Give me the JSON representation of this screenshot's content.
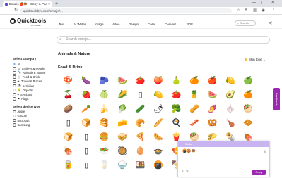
{
  "browser": {
    "tab_title": "Emojis 🍎🍩 - Copy & Paste E...",
    "tab_close": "×",
    "new_tab": "+",
    "url": "quicktoolsbyv.com/emojis/...",
    "win_min": "—",
    "win_max": "☐",
    "win_close": "×"
  },
  "header": {
    "logo_text": "Quicktools",
    "logo_sub": "By Picsart",
    "menu": [
      "Text ⌄",
      "AI Writer ⌄",
      "Image ⌄",
      "Video ⌄",
      "Design ⌄",
      "Color ⌄",
      "Convert ⌄",
      "PDF ⌄"
    ],
    "search_placeholder": "Search"
  },
  "main": {
    "search_placeholder": "Search emojis...",
    "category_heading": "Animals & Nature",
    "section_title": "Food & Drink",
    "skin_tone_label": "Skin tone"
  },
  "sidebar": {
    "category_title": "Select category",
    "categories": [
      "All",
      "Smileys & People",
      "Animals & Nature",
      "Food & Drink",
      "Travel & Places",
      "Activities",
      "Objects",
      "Symbols",
      "Flags"
    ],
    "device_title": "Select device type",
    "devices": [
      "Apple",
      "Google",
      "Microsoft",
      "Samsung"
    ]
  },
  "feedback_label": "Feedback",
  "editor": {
    "title": "Editor",
    "content": "🍘🍪🍩",
    "undo": "↶ ↷",
    "copy_label": "Copy"
  },
  "emoji_grid": [
    [
      "🍄",
      "🍆",
      "🫐",
      "🍉",
      "🍅",
      "🍑",
      "🍐",
      "🍊",
      "🍎",
      "🍋",
      "🍏"
    ],
    [
      "🍒",
      "🍓",
      "🍈",
      "🌽",
      "▯",
      "🍋",
      "🍅",
      "🍍",
      "🍉",
      "🥑",
      "🍊"
    ],
    [
      "🥔",
      "🥕",
      "🍌",
      "🥬",
      "🥒",
      "🌶",
      "🥦",
      "🥜",
      "🍠",
      "🧄",
      "🥙"
    ],
    [
      "▯",
      "🍞",
      "🥞",
      "🧀",
      "🥐",
      "🥖",
      "🍳",
      "🥓",
      "🥨",
      "🍗",
      "🧇"
    ],
    [
      "🍞",
      "▯",
      "🍔",
      "🥪",
      "🍕",
      "🌭",
      "🍟",
      "🥙",
      "🌮",
      "🌯",
      "🍖"
    ],
    [
      "🍖",
      "▯",
      "🥗",
      "🥘",
      "🥚",
      "🍲",
      "🍤",
      "🍙",
      "🍣",
      "🍱",
      "🍛"
    ],
    [
      "🥫",
      "▯",
      "🥛",
      "🍚",
      "🍱",
      "🍘",
      "🍢",
      "🍡",
      "🍧",
      "🍨",
      "🍦"
    ]
  ]
}
